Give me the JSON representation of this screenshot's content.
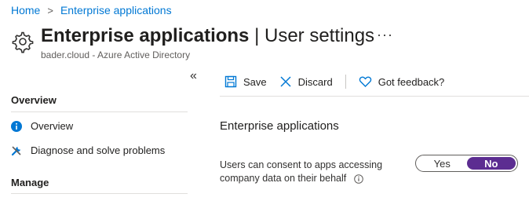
{
  "breadcrumb": {
    "home": "Home",
    "current": "Enterprise applications",
    "separator": ">"
  },
  "header": {
    "title_main": "Enterprise applications",
    "title_divider": "|",
    "title_sub": "User settings",
    "subtitle": "bader.cloud - Azure Active Directory",
    "more": "···"
  },
  "sidebar": {
    "collapse": "«",
    "sections": [
      {
        "heading": "Overview",
        "items": [
          {
            "label": "Overview",
            "icon": "info-icon"
          },
          {
            "label": "Diagnose and solve problems",
            "icon": "wrench-icon"
          }
        ]
      },
      {
        "heading": "Manage",
        "items": []
      }
    ]
  },
  "toolbar": {
    "save": "Save",
    "discard": "Discard",
    "feedback": "Got feedback?"
  },
  "content": {
    "section_title": "Enterprise applications",
    "setting_label": "Users can consent to apps accessing company data on their behalf",
    "toggle": {
      "yes": "Yes",
      "no": "No",
      "selected": "No"
    }
  },
  "colors": {
    "link": "#0078d4",
    "toggle_selected": "#5c2d91",
    "info": "#0078d4"
  }
}
